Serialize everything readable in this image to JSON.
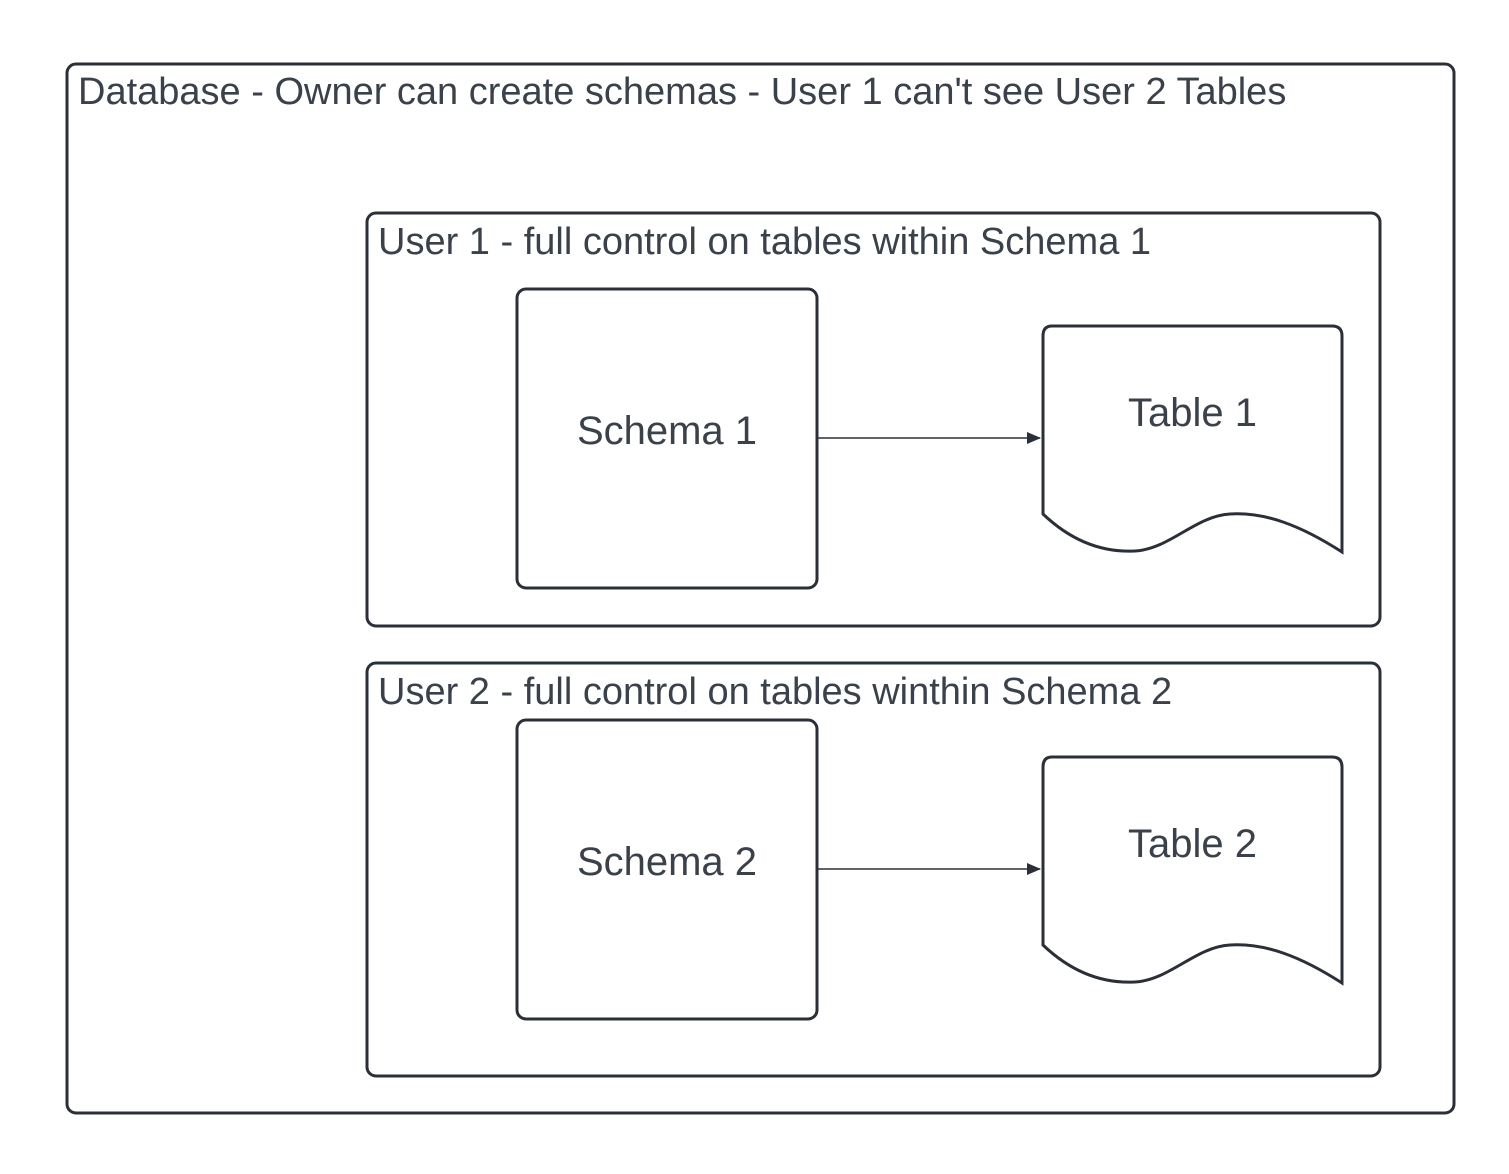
{
  "diagram": {
    "colors": {
      "stroke": "#2b3038",
      "text": "#3a414a",
      "background": "#ffffff"
    },
    "database": {
      "label": "Database - Owner can create schemas - User 1 can't see User 2 Tables"
    },
    "groups": [
      {
        "label": "User 1 - full control on tables within Schema 1",
        "schema": {
          "label": "Schema 1"
        },
        "table": {
          "label": "Table 1"
        }
      },
      {
        "label": "User 2 - full control on tables winthin Schema 2",
        "schema": {
          "label": "Schema 2"
        },
        "table": {
          "label": "Table 2"
        }
      }
    ],
    "edges": [
      {
        "from": "Schema 1",
        "to": "Table 1"
      },
      {
        "from": "Schema 2",
        "to": "Table 2"
      }
    ]
  }
}
